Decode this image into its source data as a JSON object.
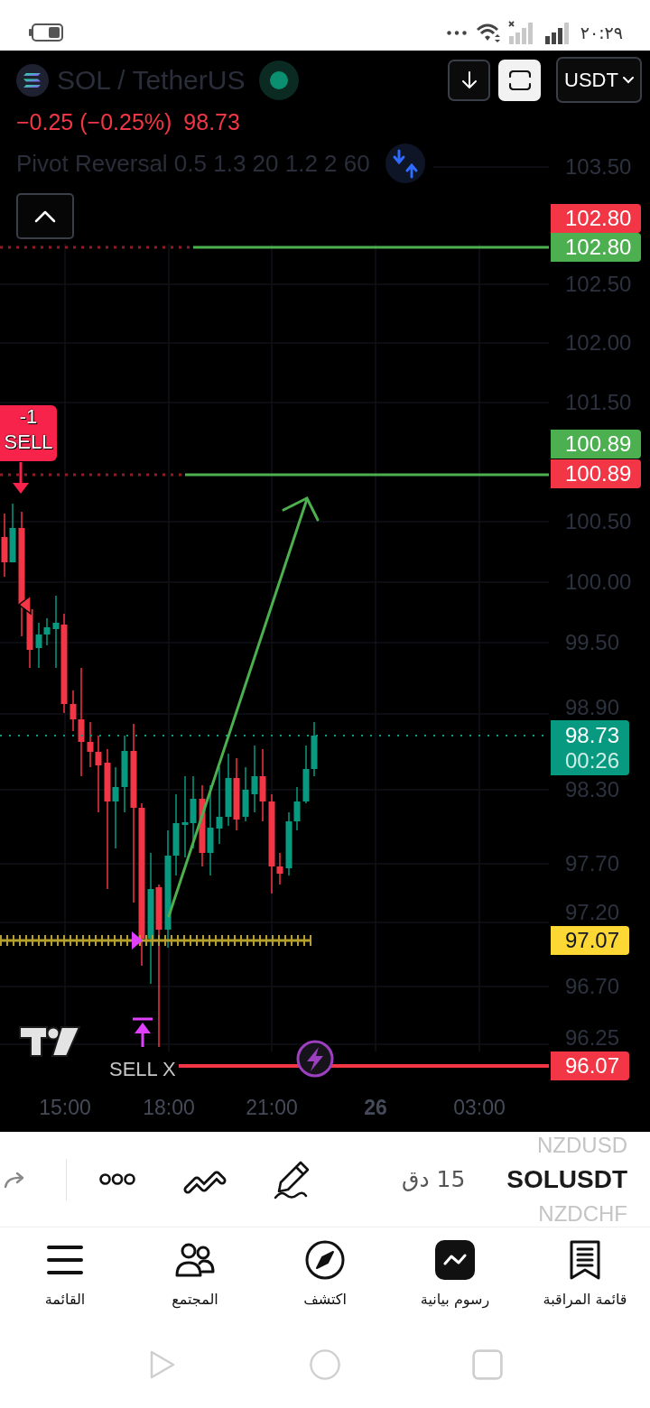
{
  "status_bar": {
    "time": "٢٠:٢٩"
  },
  "header": {
    "symbol": "SOL / TetherUS",
    "currency": "USDT",
    "change": "−0.25 (−0.25%)",
    "price": "98.73",
    "indicator": "Pivot Reversal 0.5 1.3 20 1.2 2 60"
  },
  "chart": {
    "price_axis": [
      "103.50",
      "102.50",
      "102.00",
      "101.50",
      "100.50",
      "100.00",
      "99.50",
      "98.90",
      "98.30",
      "97.70",
      "97.20",
      "96.70",
      "96.25"
    ],
    "price_tags": [
      {
        "text": "102.80",
        "color": "#f23645"
      },
      {
        "text": "102.80",
        "color": "#4caf50"
      },
      {
        "text": "100.89",
        "color": "#4caf50"
      },
      {
        "text": "100.89",
        "color": "#f23645"
      },
      {
        "text": "97.07",
        "color": "#fdd835"
      },
      {
        "text": "96.07",
        "color": "#f23645"
      }
    ],
    "current_price": {
      "price": "98.73",
      "countdown": "00:26"
    },
    "signal": {
      "count": "-1",
      "label": "SELL"
    },
    "exit_label": "SELL X",
    "time_axis": [
      {
        "label": "15:00",
        "kind": "time"
      },
      {
        "label": "18:00",
        "kind": "time"
      },
      {
        "label": "21:00",
        "kind": "time"
      },
      {
        "label": "26",
        "kind": "date"
      },
      {
        "label": "03:00",
        "kind": "time"
      }
    ]
  },
  "toolbar": {
    "symbols": [
      {
        "label": "NZDUSD",
        "selected": false
      },
      {
        "label": "SOLUSDT",
        "selected": true
      },
      {
        "label": "NZDCHF",
        "selected": false
      }
    ],
    "interval": "15 دق"
  },
  "nav": [
    {
      "label": "قائمة المراقبة",
      "selected": false
    },
    {
      "label": "رسوم بيانية",
      "selected": true
    },
    {
      "label": "اكتشف",
      "selected": false
    },
    {
      "label": "المجتمع",
      "selected": false
    },
    {
      "label": "القائمة",
      "selected": false
    }
  ]
}
